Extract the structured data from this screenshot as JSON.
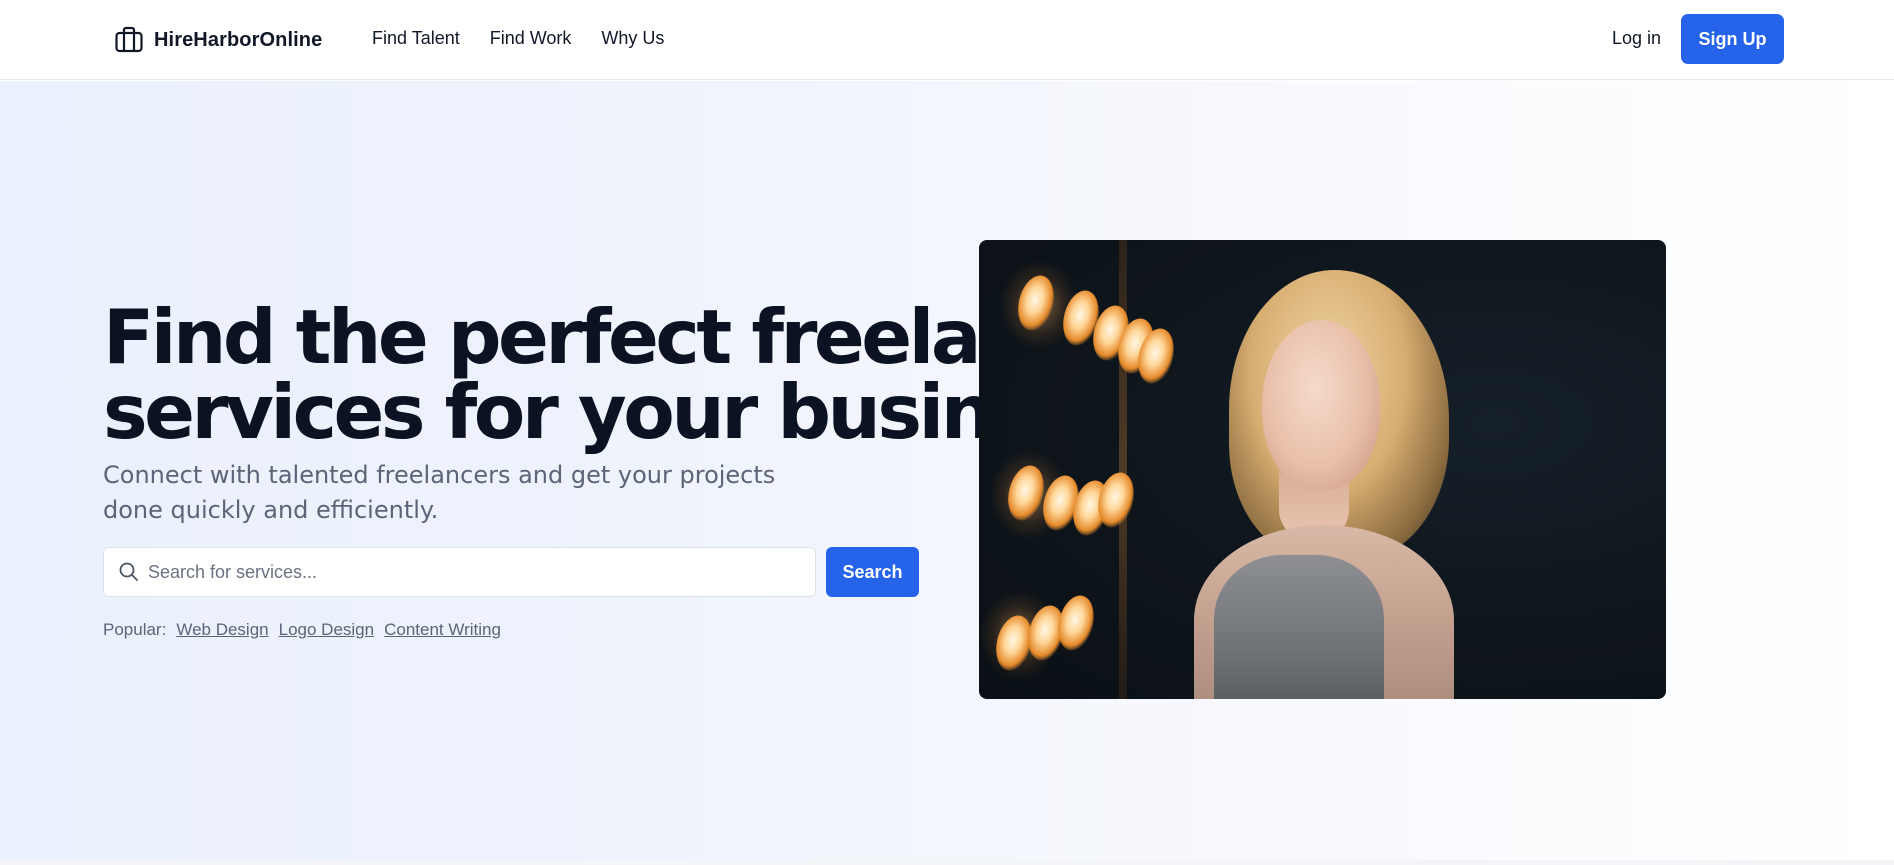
{
  "header": {
    "brand": {
      "name": "HireHarborOnline",
      "icon": "briefcase-icon"
    },
    "nav": [
      {
        "label": "Find Talent"
      },
      {
        "label": "Find Work"
      },
      {
        "label": "Why Us"
      }
    ],
    "login_label": "Log in",
    "signup_label": "Sign Up"
  },
  "hero": {
    "headline_line1": "Find the perfect freelance",
    "headline_line2": "services for your business",
    "subheadline": "Connect with talented freelancers and get your projects done quickly and efficiently.",
    "search": {
      "placeholder": "Search for services...",
      "value": "",
      "icon": "search-icon",
      "button_label": "Search"
    },
    "popular": {
      "label": "Popular:",
      "tags": [
        "Web Design",
        "Logo Design",
        "Content Writing"
      ]
    },
    "image": {
      "alt": "Woman with wavy blonde hair in front of warm light bulbs"
    }
  },
  "colors": {
    "accent": "#2563eb",
    "headline": "#0b1222",
    "muted_text": "#5b6577",
    "hero_bg_start": "#eaf0fd"
  }
}
